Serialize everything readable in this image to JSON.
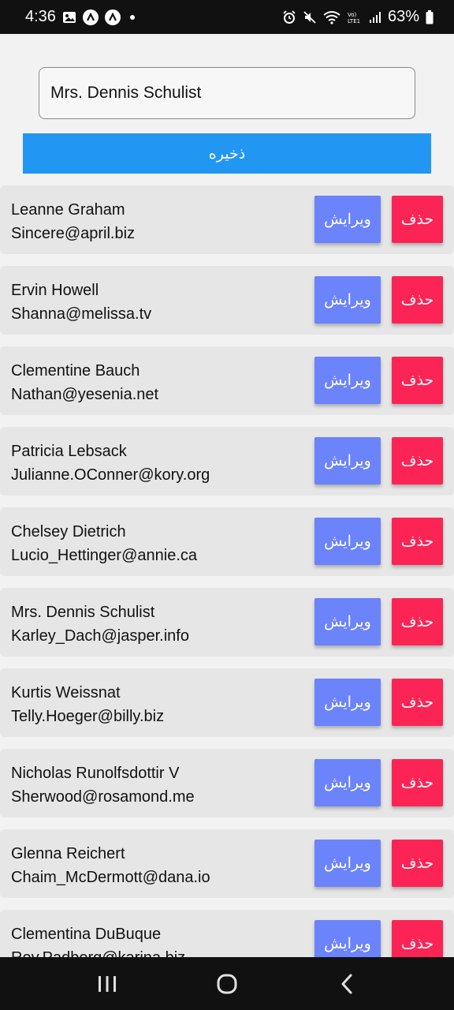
{
  "status_bar": {
    "time": "4:36",
    "battery": "63%",
    "left_icons": [
      "gallery-icon",
      "app-a-icon",
      "app-a-icon",
      "notification-dot-icon"
    ],
    "right_icons": [
      "alarm-icon",
      "mute-icon",
      "wifi-icon",
      "volte-icon",
      "signal-icon",
      "battery-icon"
    ]
  },
  "form": {
    "name_value": "Mrs. Dennis Schulist",
    "save_label": "ذخیره"
  },
  "users": [
    {
      "name": "Leanne Graham",
      "email": "Sincere@april.biz"
    },
    {
      "name": "Ervin Howell",
      "email": "Shanna@melissa.tv"
    },
    {
      "name": "Clementine Bauch",
      "email": "Nathan@yesenia.net"
    },
    {
      "name": "Patricia Lebsack",
      "email": "Julianne.OConner@kory.org"
    },
    {
      "name": "Chelsey Dietrich",
      "email": "Lucio_Hettinger@annie.ca"
    },
    {
      "name": "Mrs. Dennis Schulist",
      "email": "Karley_Dach@jasper.info"
    },
    {
      "name": "Kurtis Weissnat",
      "email": "Telly.Hoeger@billy.biz"
    },
    {
      "name": "Nicholas Runolfsdottir V",
      "email": "Sherwood@rosamond.me"
    },
    {
      "name": "Glenna Reichert",
      "email": "Chaim_McDermott@dana.io"
    },
    {
      "name": "Clementina DuBuque",
      "email": "Rey.Padberg@karina.biz"
    }
  ],
  "row_actions": {
    "edit_label": "ویرایش",
    "delete_label": "حذف"
  },
  "colors": {
    "save_button": "#2196f3",
    "edit_button": "#6b83fb",
    "delete_button": "#fc2455",
    "row_background": "#e6e6e6",
    "page_background": "#f2f2f2"
  },
  "nav_bar": {
    "icons": [
      "recent-apps-icon",
      "home-icon",
      "back-icon"
    ]
  }
}
